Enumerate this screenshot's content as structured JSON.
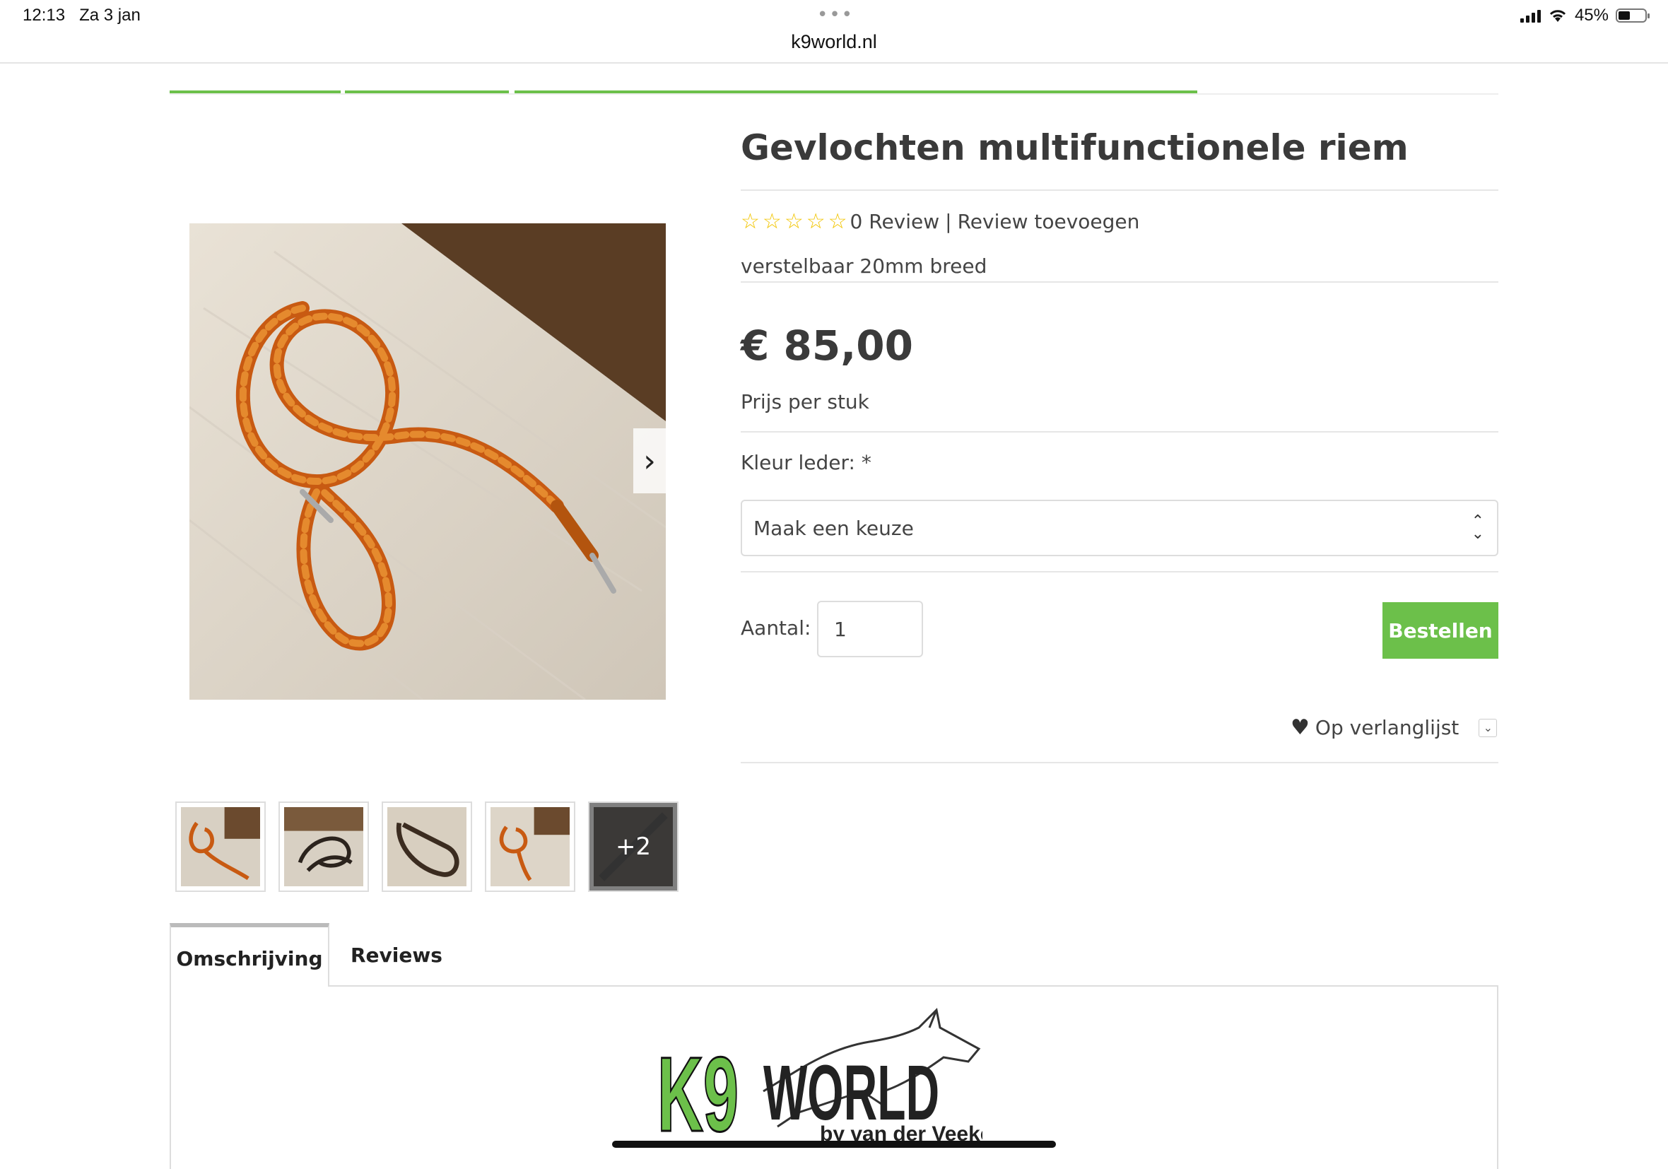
{
  "status_bar": {
    "time": "12:13",
    "date": "Za 3 jan",
    "url": "k9world.nl",
    "battery": "45%",
    "battery_level": 0.45
  },
  "product": {
    "title": "Gevlochten multifunctionele riem",
    "rating_stars": 0,
    "review_count_label": "0 Review",
    "review_separator": "|",
    "add_review_label": "Review toevoegen",
    "subtitle": "verstelbaar 20mm breed",
    "price": "€ 85,00",
    "price_note": "Prijs per stuk",
    "option_label": "Kleur leder: *",
    "option_select_value": "Maak een keuze",
    "quantity_label": "Aantal:",
    "quantity_value": "1",
    "order_button": "Bestellen",
    "wishlist_label": "Op verlanglijst"
  },
  "gallery": {
    "more_count": "+2",
    "thumbnail_count": 5
  },
  "tabs": {
    "description": "Omschrijving",
    "reviews": "Reviews"
  },
  "logo": {
    "brand": "K9WORLD",
    "tagline": "by van der Veeke"
  },
  "colors": {
    "accent_green": "#6cc04a",
    "star_yellow": "#f2c500",
    "text_dark": "#3a3a3a"
  }
}
